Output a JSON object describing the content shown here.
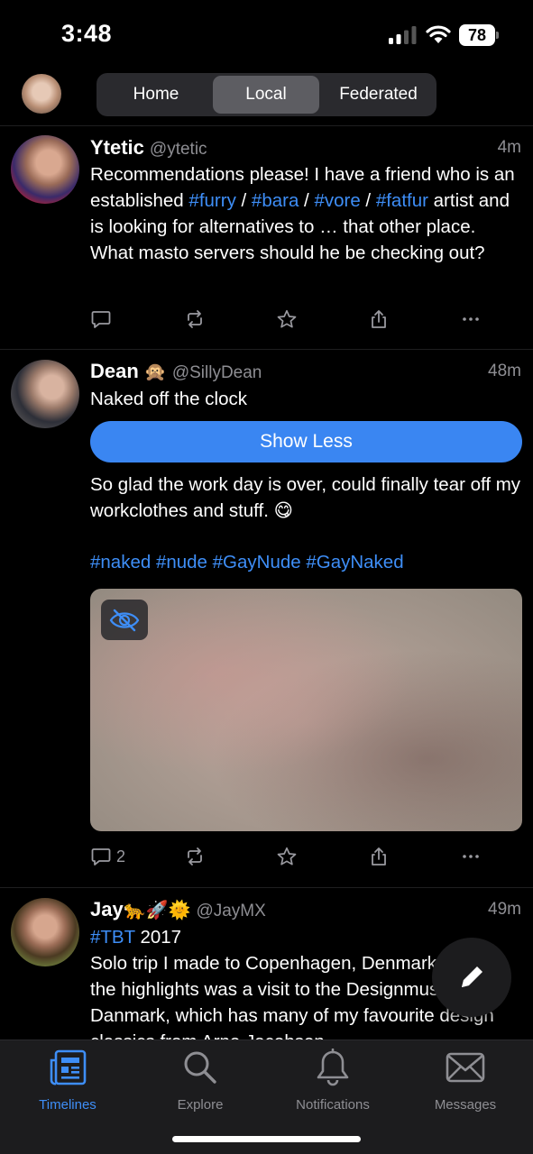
{
  "status_bar": {
    "time": "3:48",
    "battery": "78"
  },
  "header": {
    "tabs": [
      {
        "label": "Home",
        "selected": false
      },
      {
        "label": "Local",
        "selected": true
      },
      {
        "label": "Federated",
        "selected": false
      }
    ]
  },
  "posts": [
    {
      "name": "Ytetic",
      "handle": "@ytetic",
      "time": "4m",
      "text_before": "Recommendations please! I have a friend who is an established ",
      "tags": [
        "#furry",
        "#bara",
        "#vore",
        "#fatfur"
      ],
      "separator": " / ",
      "text_after": " artist and is looking for alternatives to … that other place. What masto servers should he be checking out?"
    },
    {
      "name": "Dean",
      "name_emoji": "🙊",
      "handle": "@SillyDean",
      "time": "48m",
      "content_warning": "Naked off the clock",
      "show_less_label": "Show Less",
      "text": "So glad the work day is over, could finally tear off my workclothes and stuff. 😋",
      "hashtags": "#naked #nude #GayNude #GayNaked",
      "reply_count": "2"
    },
    {
      "name": "Jay",
      "name_emoji": "🐆🚀🌞",
      "handle": "@JayMX",
      "time": "49m",
      "tag": "#TBT",
      "year": " 2017",
      "text": "Solo trip I made to Copenhagen, Denmark. One of the highlights was a visit to the Designmuseum Danmark, which has many of my favourite design classics from Arne Jacobsen"
    }
  ],
  "tabbar": [
    {
      "label": "Timelines",
      "icon": "timelines-icon",
      "active": true
    },
    {
      "label": "Explore",
      "icon": "search-icon",
      "active": false
    },
    {
      "label": "Notifications",
      "icon": "bell-icon",
      "active": false
    },
    {
      "label": "Messages",
      "icon": "envelope-icon",
      "active": false
    }
  ],
  "colors": {
    "accent": "#3e8ef7",
    "show_less_button": "#3a86f2",
    "background": "#000000"
  }
}
